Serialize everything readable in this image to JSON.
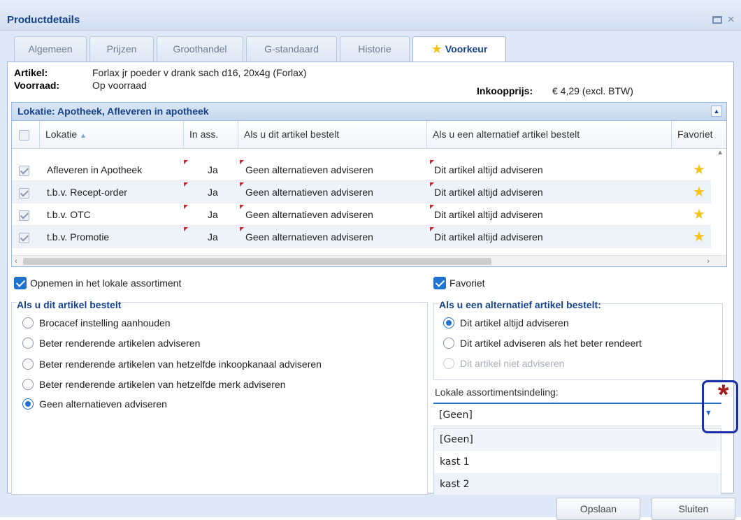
{
  "window": {
    "title": "Productdetails"
  },
  "tabs": [
    {
      "label": "Algemeen",
      "active": false
    },
    {
      "label": "Prijzen",
      "active": false
    },
    {
      "label": "Groothandel",
      "active": false
    },
    {
      "label": "G-standaard",
      "active": false
    },
    {
      "label": "Historie",
      "active": false
    },
    {
      "label": "Voorkeur",
      "active": true,
      "icon": "star-icon"
    }
  ],
  "info": {
    "artikel_label": "Artikel:",
    "artikel_value": "Forlax jr poeder v drank sach d16, 20x4g (Forlax)",
    "voorraad_label": "Voorraad:",
    "voorraad_value": "Op voorraad",
    "inkoop_label": "Inkoopprijs:",
    "inkoop_value": "€ 4,29 (excl. BTW)"
  },
  "grid": {
    "title": "Lokatie: Apotheek, Afleveren in apotheek",
    "columns": [
      "Lokatie",
      "In ass.",
      "Als u dit artikel bestelt",
      "Als u een alternatief artikel bestelt",
      "Favoriet"
    ],
    "rows": [
      {
        "checked": true,
        "lokatie": "Afleveren in Apotheek",
        "in_ass": "Ja",
        "bestelt": "Geen alternatieven adviseren",
        "alternatief": "Dit artikel altijd adviseren",
        "favoriet": true
      },
      {
        "checked": true,
        "lokatie": "t.b.v. Recept-order",
        "in_ass": "Ja",
        "bestelt": "Geen alternatieven adviseren",
        "alternatief": "Dit artikel altijd adviseren",
        "favoriet": true
      },
      {
        "checked": true,
        "lokatie": "t.b.v. OTC",
        "in_ass": "Ja",
        "bestelt": "Geen alternatieven adviseren",
        "alternatief": "Dit artikel altijd adviseren",
        "favoriet": true
      },
      {
        "checked": true,
        "lokatie": "t.b.v. Promotie",
        "in_ass": "Ja",
        "bestelt": "Geen alternatieven adviseren",
        "alternatief": "Dit artikel altijd adviseren",
        "favoriet": true
      }
    ]
  },
  "options": {
    "opnemen_label": "Opnemen in het lokale assortiment",
    "opnemen_checked": true,
    "favoriet_label": "Favoriet",
    "favoriet_checked": true
  },
  "left_group": {
    "title": "Als u dit artikel bestelt",
    "options": [
      {
        "label": "Brocacef instelling aanhouden",
        "selected": false
      },
      {
        "label": "Beter renderende artikelen adviseren",
        "selected": false
      },
      {
        "label": "Beter renderende artikelen van hetzelfde inkoopkanaal adviseren",
        "selected": false
      },
      {
        "label": "Beter renderende artikelen van hetzelfde merk adviseren",
        "selected": false
      },
      {
        "label": "Geen alternatieven adviseren",
        "selected": true
      }
    ]
  },
  "right_group": {
    "title": "Als u een alternatief artikel bestelt:",
    "options": [
      {
        "label": "Dit artikel altijd adviseren",
        "selected": true,
        "disabled": false
      },
      {
        "label": "Dit artikel adviseren als het beter rendeert",
        "selected": false,
        "disabled": false
      },
      {
        "label": "Dit artikel niet adviseren",
        "selected": false,
        "disabled": true
      }
    ]
  },
  "assortiment": {
    "label": "Lokale assortimentsindeling:",
    "value": "[Geen]",
    "options": [
      "[Geen]",
      "kast 1",
      "kast 2"
    ]
  },
  "annotation": {
    "marker": "*",
    "color": "#a6191a",
    "border_color": "#1a2fa8"
  },
  "buttons": {
    "save": "Opslaan",
    "close": "Sluiten"
  },
  "colors": {
    "accent": "#1f72d0",
    "title": "#15428b",
    "star": "#f5c21a",
    "dirty_marker": "#d22222"
  }
}
